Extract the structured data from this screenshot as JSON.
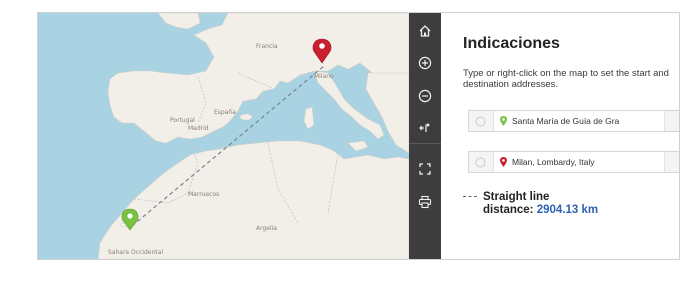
{
  "panel": {
    "title": "Indicaciones",
    "description": "Type or right-click on the map to set the start and destination addresses.",
    "start_address": "Santa María de Guía de Gra",
    "destination_address": "Milan, Lombardy, Italy",
    "distance_label_line1": "Straight line",
    "distance_label_line2": "distance:",
    "distance_value": "2904.13 km"
  },
  "toolbar": {
    "icons": [
      "home-icon",
      "zoom-in-icon",
      "zoom-out-icon",
      "swap-direction-icon",
      "fullscreen-icon",
      "print-icon"
    ]
  },
  "map": {
    "labels": [
      "Francia",
      "Milano",
      "España",
      "Portugal",
      "Madrid",
      "Marruecos",
      "Argelia",
      "Sahara Occidental"
    ]
  },
  "colors": {
    "water": "#a9d3e2",
    "land": "#f2efe9",
    "toolbar": "#3d3d3d",
    "start_pin": "#7bc242",
    "end_pin": "#c8202f",
    "distance_value": "#2b62b3"
  }
}
